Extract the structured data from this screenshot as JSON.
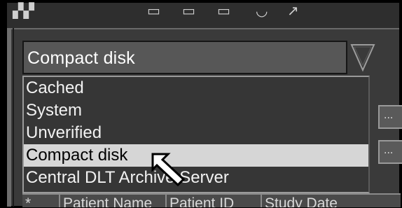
{
  "combo": {
    "value": "Compact disk"
  },
  "dropdown": {
    "options": [
      "Cached",
      "System",
      "Unverified",
      "Compact disk",
      "Central DLT Archive Server"
    ],
    "selected_index": 3
  },
  "side_buttons": {
    "label": "..."
  },
  "table": {
    "columns": [
      "*",
      "Patient Name",
      "Patient ID",
      "Study Date"
    ]
  },
  "colors": {
    "background": "#3a3a3a",
    "selection": "#d6d6d6",
    "text": "#f2f2f2"
  },
  "icons": [
    "toolbar-icons",
    "dropdown-arrow-icon",
    "mouse-pointer-icon"
  ]
}
